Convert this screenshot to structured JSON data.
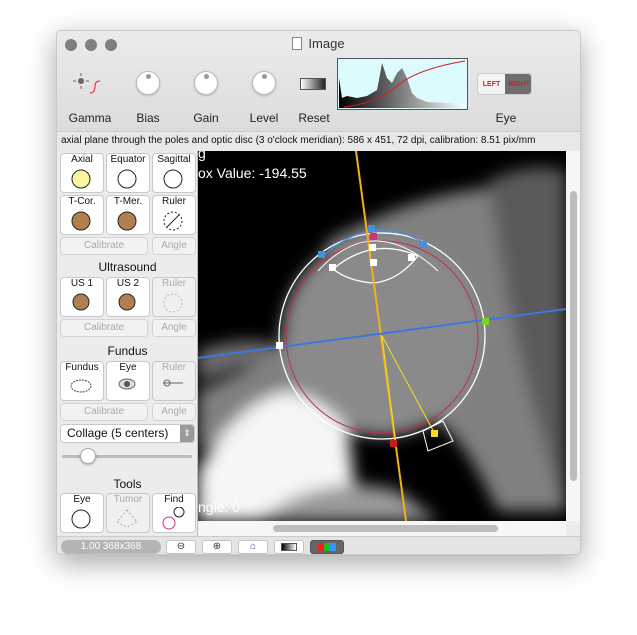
{
  "window": {
    "title": "Image"
  },
  "toolbar": {
    "gamma": "Gamma",
    "bias": "Bias",
    "gain": "Gain",
    "level": "Level",
    "reset": "Reset",
    "eye": "Eye",
    "left": "LEFT",
    "right": "RIGHT"
  },
  "status": "axial plane through the poles and optic disc (3 o'clock meridian): 586 x 451, 72 dpi, calibration: 8.51 pix/mm",
  "ct": {
    "buttons": [
      "Axial",
      "Equator",
      "Sagittal",
      "T-Cor.",
      "T-Mer.",
      "Ruler"
    ],
    "calibrate": "Calibrate",
    "angle": "Angle"
  },
  "ultrasound": {
    "title": "Ultrasound",
    "buttons": [
      "US 1",
      "US 2",
      "Ruler"
    ],
    "calibrate": "Calibrate",
    "angle": "Angle"
  },
  "fundus": {
    "title": "Fundus",
    "buttons": [
      "Fundus",
      "Eye",
      "Ruler"
    ],
    "calibrate": "Calibrate",
    "angle": "Angle"
  },
  "collage": {
    "selected": "Collage (5 centers)",
    "slider": 0.2
  },
  "tools": {
    "title": "Tools",
    "buttons": [
      "Eye",
      "Tumor",
      "Find"
    ]
  },
  "viewer": {
    "top_text": "g",
    "value_text": "ox Value: -194.55",
    "angle_text": "ngle: 0"
  },
  "footer": {
    "zoom": "1.00 368x368"
  },
  "colors": {
    "yellow_axis": "#f2b01e",
    "blue_axis": "#3a78e0",
    "red_circle": "#c0304a"
  }
}
